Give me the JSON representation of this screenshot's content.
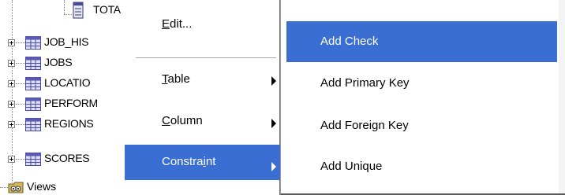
{
  "tree": {
    "sub_item_label": "TOTA",
    "items": [
      {
        "label": "JOB_HIS"
      },
      {
        "label": "JOBS"
      },
      {
        "label": "LOCATIO"
      },
      {
        "label": "PERFORM"
      },
      {
        "label": "REGIONS"
      },
      {
        "label": "SCORES"
      }
    ],
    "views_label": "Views"
  },
  "context_menu": {
    "items": [
      {
        "label": "Edit...",
        "mnemonic_index": 0
      },
      {
        "label": "Table",
        "mnemonic_index": 0,
        "has_submenu": true
      },
      {
        "label": "Column",
        "mnemonic_index": 0,
        "has_submenu": true
      },
      {
        "label": "Constraint",
        "mnemonic_index": 7,
        "has_submenu": true,
        "active": true
      }
    ]
  },
  "submenu": {
    "items": [
      {
        "label": "Add Check",
        "active": true
      },
      {
        "label": "Add Primary Key"
      },
      {
        "label": "Add Foreign Key"
      },
      {
        "label": "Add Unique"
      }
    ]
  },
  "colors": {
    "highlight": "#3a6ed2",
    "table_icon": "#5a5ab4"
  }
}
